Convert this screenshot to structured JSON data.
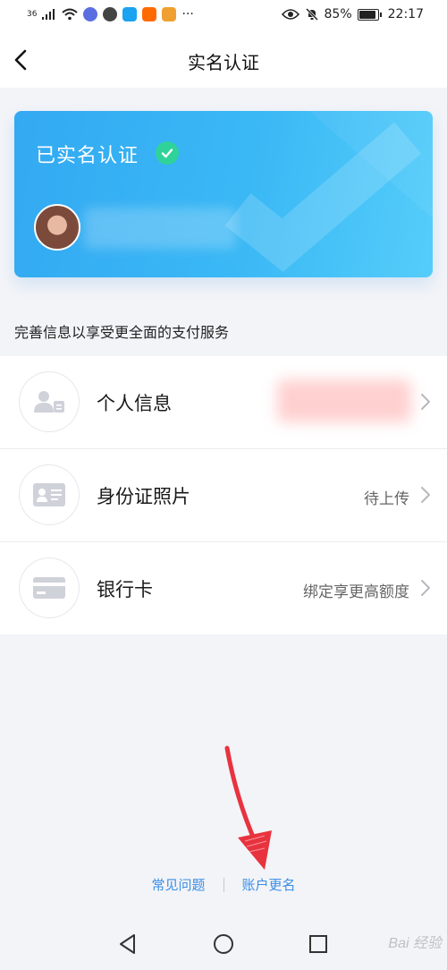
{
  "status_bar": {
    "signal": "36",
    "battery": "85%",
    "time": "22:17",
    "more": "···"
  },
  "header": {
    "title": "实名认证"
  },
  "card": {
    "status": "已实名认证"
  },
  "section_hint": "完善信息以享受更全面的支付服务",
  "rows": [
    {
      "label": "个人信息",
      "value": "",
      "icon": "person-card-icon"
    },
    {
      "label": "身份证照片",
      "value": "待上传",
      "icon": "id-card-icon"
    },
    {
      "label": "银行卡",
      "value": "绑定享更高额度",
      "icon": "bank-card-icon"
    }
  ],
  "footer": {
    "faq": "常见问题",
    "rename": "账户更名"
  },
  "watermark": "Bai 经验",
  "colors": {
    "card_start": "#33a9f2",
    "card_end": "#55cdfa",
    "verified_green": "#2fd39a",
    "link_blue": "#3a8ee6",
    "annotation_red": "#e8333f"
  }
}
